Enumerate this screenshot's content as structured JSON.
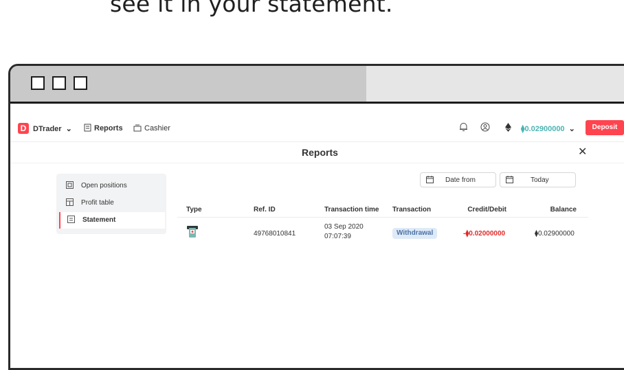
{
  "caption": "see it in your statement.",
  "nav": {
    "platform_label": "DTrader",
    "reports_label": "Reports",
    "cashier_label": "Cashier",
    "balance": "0.02900000",
    "deposit_label": "Deposit"
  },
  "page": {
    "title": "Reports"
  },
  "sidebar": {
    "items": [
      {
        "label": "Open positions",
        "icon": "open-positions-icon"
      },
      {
        "label": "Profit table",
        "icon": "profit-table-icon"
      },
      {
        "label": "Statement",
        "icon": "statement-icon",
        "active": true
      }
    ]
  },
  "filters": {
    "date_from": "Date from",
    "date_to": "Today"
  },
  "table": {
    "columns": [
      "Type",
      "Ref. ID",
      "Transaction time",
      "Transaction",
      "Credit/Debit",
      "Balance"
    ],
    "rows": [
      {
        "type_icon": "withdrawal-icon",
        "ref_id": "49768010841",
        "time_date": "03 Sep 2020",
        "time_clock": "07:07:39",
        "transaction": "Withdrawal",
        "amount": "-0.02000000",
        "balance": "0.02900000"
      }
    ]
  },
  "colors": {
    "brand": "#ff444f",
    "balance": "#4bb4b3",
    "debit": "#e02a2a",
    "badge_bg": "#dfeaf7"
  }
}
